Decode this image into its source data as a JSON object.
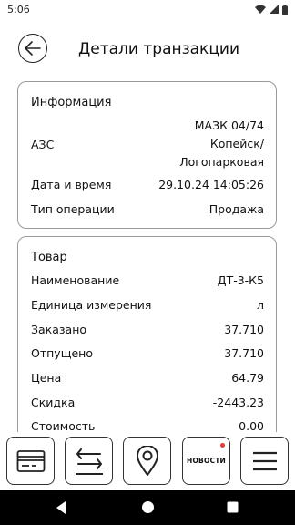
{
  "status_bar": {
    "time": "5:06"
  },
  "header": {
    "title": "Детали транзакции"
  },
  "info_card": {
    "heading": "Информация",
    "station_label": "АЗС",
    "station_value_lines": [
      "МАЗК 04/74",
      "Копейск/",
      "Логопарковая"
    ],
    "datetime_label": "Дата и время",
    "datetime_value": "29.10.24 14:05:26",
    "operation_label": "Тип операции",
    "operation_value": "Продажа"
  },
  "goods_card": {
    "heading": "Товар",
    "rows": [
      {
        "label": "Наименование",
        "value": "ДТ-3-К5"
      },
      {
        "label": "Единица измерения",
        "value": "л"
      },
      {
        "label": "Заказано",
        "value": "37.710"
      },
      {
        "label": "Отпущено",
        "value": "37.710"
      },
      {
        "label": "Цена",
        "value": "64.79"
      },
      {
        "label": "Скидка",
        "value": "-2443.23"
      },
      {
        "label": "Стоимость",
        "value": "0.00"
      }
    ]
  },
  "bottom_nav": {
    "news_label": "НОВОСТИ",
    "icons": [
      "card-icon",
      "transfer-icon",
      "location-pin-icon",
      "news-icon",
      "menu-icon"
    ]
  },
  "colors": {
    "card_border": "#9a9a9a",
    "notification_dot": "#e53935",
    "system_nav": "#000000"
  }
}
